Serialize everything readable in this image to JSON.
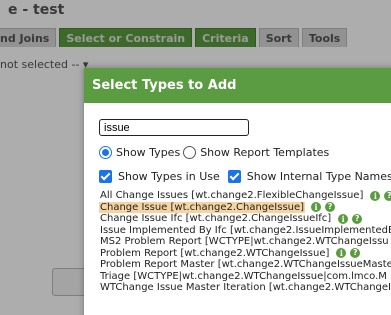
{
  "background": {
    "title": "e - test",
    "tabs": [
      {
        "label": "nd Joins",
        "green": false
      },
      {
        "label": "Select or Constrain",
        "green": true
      },
      {
        "label": "Criteria",
        "green": true
      },
      {
        "label": "Sort",
        "green": false
      },
      {
        "label": "Tools",
        "green": false
      }
    ],
    "select_text": "not selected --  ▾"
  },
  "dialog": {
    "title": "Select Types to Add",
    "search": {
      "value": "issue",
      "placeholder": ""
    },
    "radios": [
      {
        "label": "Show Types",
        "checked": true
      },
      {
        "label": "Show Report Templates",
        "checked": false
      }
    ],
    "checkboxes": [
      {
        "label": "Show Types in Use",
        "checked": true
      },
      {
        "label": "Show Internal Type Names",
        "checked": true
      }
    ],
    "types": [
      {
        "label": "All Change Issues [wt.change2.FlexibleChangeIssue]",
        "highlight": false,
        "icons": [
          "info-icon",
          "help-icon"
        ]
      },
      {
        "label": "Change Issue [wt.change2.ChangeIssue]",
        "highlight": true,
        "icons": [
          "info-icon",
          "help-icon"
        ]
      },
      {
        "label": "Change Issue Ifc [wt.change2.ChangeIssueIfc]",
        "highlight": false,
        "icons": [
          "info-icon",
          "help-icon"
        ]
      },
      {
        "label": "Issue Implemented By Ifc [wt.change2.IssueImplementedBy",
        "highlight": false,
        "icons": []
      },
      {
        "label": "MS2 Problem Report [WCTYPE|wt.change2.WTChangeIssu",
        "highlight": false,
        "icons": []
      },
      {
        "label": "Problem Report [wt.change2.WTChangeIssue]",
        "highlight": false,
        "icons": [
          "info-icon",
          "help-icon"
        ]
      },
      {
        "label": "Problem Report Master [wt.change2.WTChangeIssueMaste",
        "highlight": false,
        "icons": []
      },
      {
        "label": "Triage [WCTYPE|wt.change2.WTChangeIssue|com.lmco.M",
        "highlight": false,
        "icons": []
      },
      {
        "label": "WTChange Issue Master Iteration [wt.change2.WTChangeIs",
        "highlight": false,
        "icons": []
      }
    ]
  },
  "icon_glyphs": {
    "info-icon": "i",
    "help-icon": "?"
  },
  "colors": {
    "header_green": "#5b9c43",
    "highlight": "#f6d3a3",
    "accent_blue": "#1a73e8"
  }
}
